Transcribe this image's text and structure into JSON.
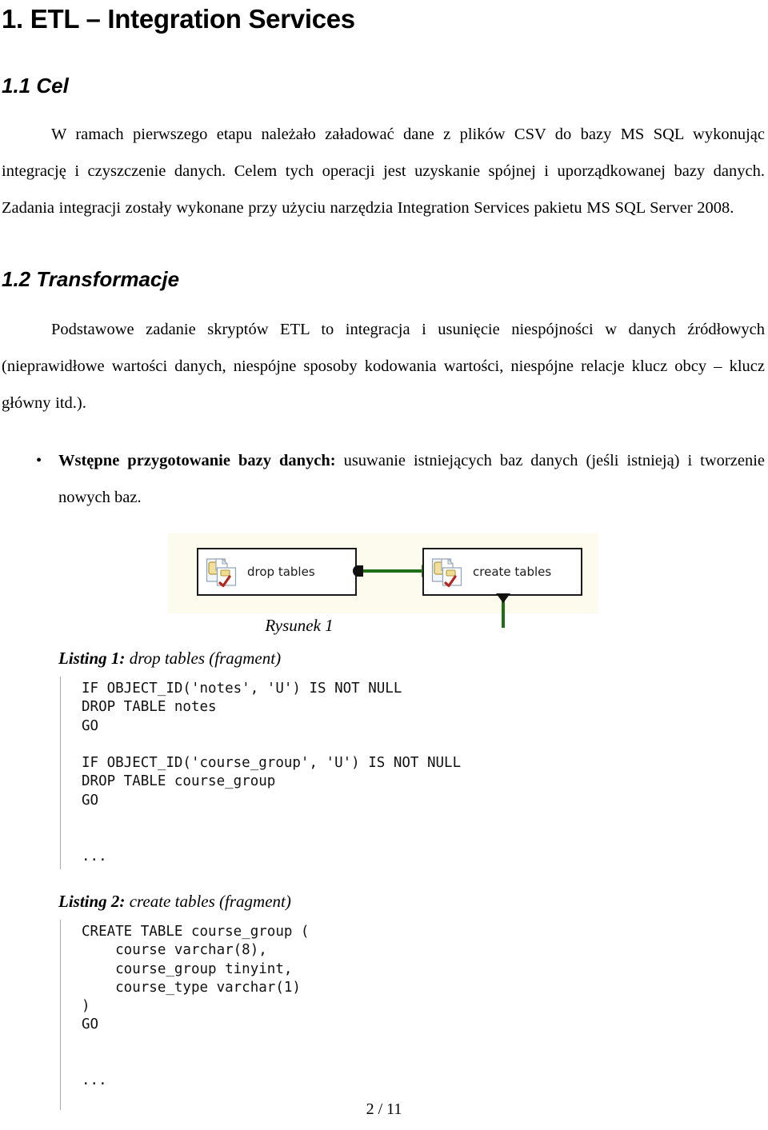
{
  "document": {
    "h1": "1. ETL – Integration Services",
    "sections": {
      "cel": {
        "heading": "1.1 Cel",
        "paragraph": "W ramach pierwszego etapu należało załadować dane z plików CSV do bazy MS SQL wykonując integrację i czyszczenie danych. Celem tych operacji jest uzyskanie spójnej i uporządkowanej bazy danych. Zadania integracji zostały wykonane przy użyciu narzędzia Integration Services pakietu MS SQL Server 2008."
      },
      "transformacje": {
        "heading": "1.2 Transformacje",
        "paragraph": "Podstawowe zadanie skryptów ETL to integracja i usunięcie niespójności w danych źródłowych (nieprawidłowe wartości danych, niespójne sposoby kodowania wartości, niespójne relacje klucz obcy – klucz główny itd.).",
        "bullet": {
          "marker": "•",
          "bold_lead": "Wstępne przygotowanie bazy danych:",
          "rest": " usuwanie istniejących baz danych (jeśli istnieją) i tworzenie nowych baz."
        }
      }
    },
    "figure": {
      "caption": "Rysunek 1",
      "background_color": "#fdfbee",
      "arrow_color": "#1f6e16",
      "tasks": [
        {
          "label": "drop tables",
          "icon": "execute-sql-task-icon"
        },
        {
          "label": "create tables",
          "icon": "execute-sql-task-icon"
        }
      ]
    },
    "listings": [
      {
        "lead": "Listing 1:",
        "title": " drop tables (fragment)",
        "code": "IF OBJECT_ID('notes', 'U') IS NOT NULL\nDROP TABLE notes\nGO\n\nIF OBJECT_ID('course_group', 'U') IS NOT NULL\nDROP TABLE course_group\nGO\n\n\n..."
      },
      {
        "lead": "Listing 2:",
        "title": " create tables (fragment)",
        "code": "CREATE TABLE course_group (\n    course varchar(8),\n    course_group tinyint,\n    course_type varchar(1)\n)\nGO\n\n\n..."
      }
    ],
    "footer": "2 / 11"
  }
}
